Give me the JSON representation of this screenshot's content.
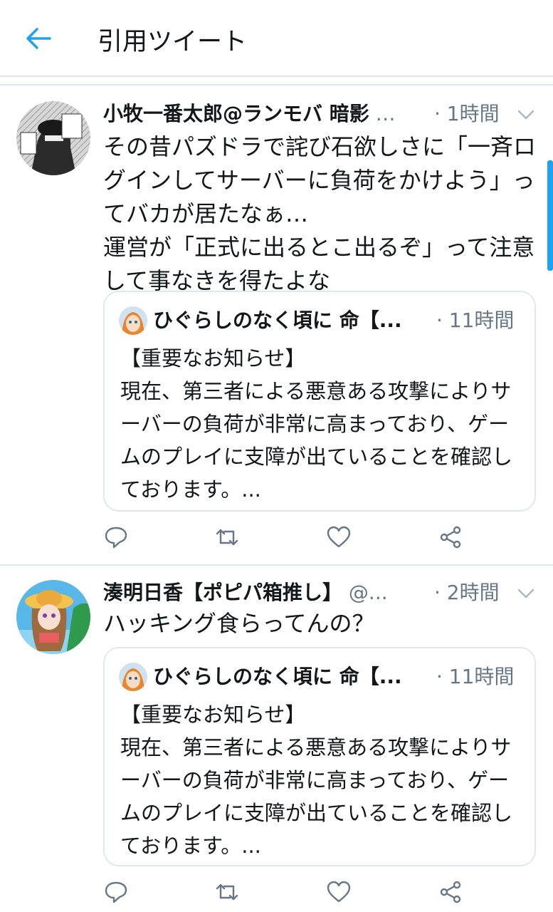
{
  "header": {
    "title": "引用ツイート"
  },
  "colors": {
    "accent": "#1da1f2",
    "text": "#14171a",
    "muted": "#657786",
    "border": "#e1e8ed"
  },
  "tweets": [
    {
      "name": "小牧一番太郎@ランモバ 暗影",
      "handle": "…",
      "time": "· 1時間",
      "text": "その昔パズドラで詫び石欲しさに「一斉ログインしてサーバーに負荷をかけよう」ってバカが居たなぁ…\n運営が「正式に出るとこ出るぞ」って注意して事なきを得たよな",
      "quote": {
        "name": "ひぐらしのなく頃に 命【...",
        "time": "· 11時間",
        "text": "【重要なお知らせ】\n現在、第三者による悪意ある攻撃によりサーバーの負荷が非常に高まっており、ゲームのプレイに支障が出ていることを確認しております。..."
      }
    },
    {
      "name": "湊明日香【ポピパ箱推し】",
      "handle": "@...",
      "time": "· 2時間",
      "text": "ハッキング食らってんの？",
      "quote": {
        "name": "ひぐらしのなく頃に 命【...",
        "time": "· 11時間",
        "text": "【重要なお知らせ】\n現在、第三者による悪意ある攻撃によりサーバーの負荷が非常に高まっており、ゲームのプレイに支障が出ていることを確認しております。..."
      }
    }
  ],
  "icons": [
    "back-arrow-icon",
    "chevron-down-icon",
    "reply-icon",
    "retweet-icon",
    "like-icon",
    "share-icon"
  ]
}
